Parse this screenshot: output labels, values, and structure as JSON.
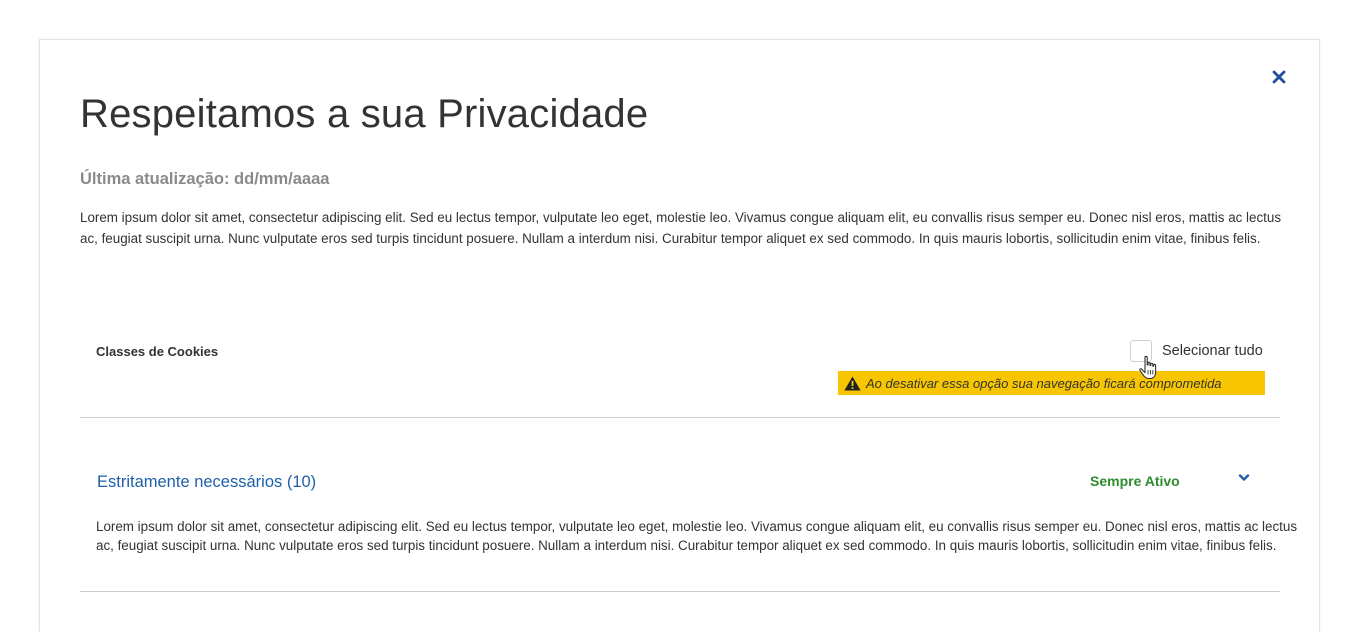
{
  "modal": {
    "title": "Respeitamos a sua Privacidade",
    "last_updated": "Última atualização: dd/mm/aaaa",
    "intro": "Lorem ipsum dolor sit amet, consectetur adipiscing elit. Sed eu lectus tempor, vulputate leo eget, molestie leo. Vivamus congue aliquam elit, eu convallis risus semper eu. Donec nisl eros, mattis ac lectus ac, feugiat suscipit urna. Nunc vulputate eros sed turpis tincidunt posuere. Nullam a interdum nisi. Curabitur tempor aliquet ex sed commodo. In quis mauris lobortis, sollicitudin enim vitae, finibus felis.",
    "close_icon": "close-icon"
  },
  "cookies": {
    "classes_label": "Classes de Cookies",
    "select_all_label": "Selecionar tudo",
    "select_all_checked": false,
    "warning_text": "Ao desativar essa opção sua navegação ficará comprometida",
    "warning_icon": "warning-icon"
  },
  "sections": [
    {
      "title": "Estritamente necessários (10)",
      "status": "Sempre Ativo",
      "description": "Lorem ipsum dolor sit amet, consectetur adipiscing elit. Sed eu lectus tempor, vulputate leo eget, molestie leo. Vivamus congue aliquam elit, eu convallis risus semper eu. Donec nisl eros, mattis ac lectus ac, feugiat suscipit urna. Nunc vulputate eros sed turpis tincidunt posuere. Nullam a interdum nisi. Curabitur tempor aliquet ex sed commodo. In quis mauris lobortis, sollicitudin enim vitae, finibus felis.",
      "expand_icon": "chevron-down-icon"
    }
  ],
  "colors": {
    "link_blue": "#1f5fa8",
    "active_green": "#2e8b2e",
    "warning_yellow": "#f7c600",
    "close_blue": "#1f4f9c"
  }
}
